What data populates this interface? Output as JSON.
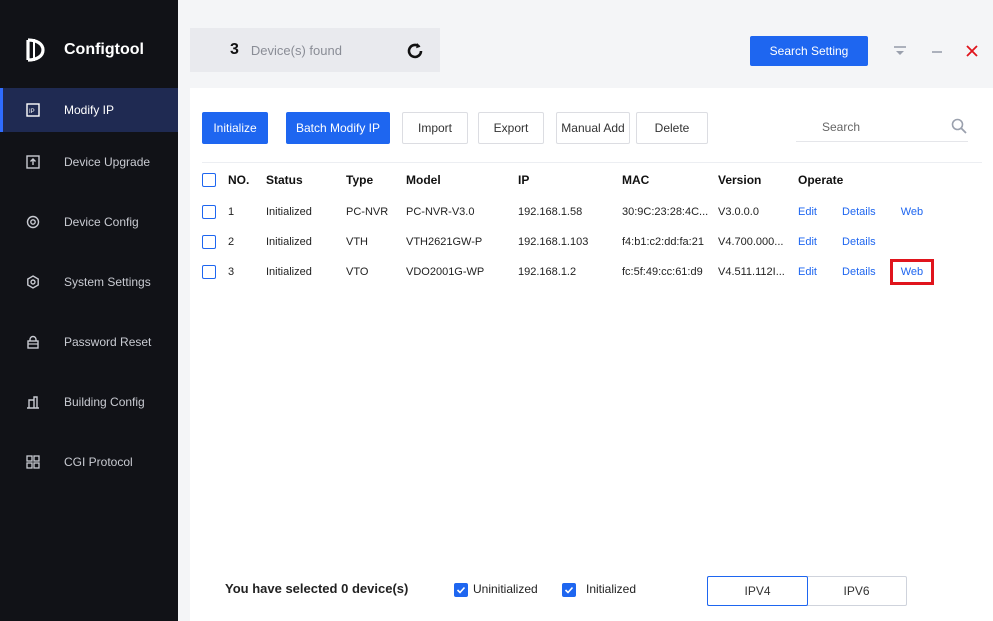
{
  "app": {
    "name": "Configtool"
  },
  "sidebar": {
    "items": [
      {
        "label": "Modify IP",
        "icon": "ip-icon",
        "active": true
      },
      {
        "label": "Device Upgrade",
        "icon": "upgrade-icon"
      },
      {
        "label": "Device Config",
        "icon": "device-config-icon"
      },
      {
        "label": "System Settings",
        "icon": "settings-icon"
      },
      {
        "label": "Password Reset",
        "icon": "lock-icon"
      },
      {
        "label": "Building Config",
        "icon": "building-icon"
      },
      {
        "label": "CGI Protocol",
        "icon": "cgi-icon"
      }
    ]
  },
  "topbar": {
    "device_count": "3",
    "found_label": "Device(s) found",
    "search_setting_label": "Search Setting"
  },
  "toolbar": {
    "initialize": "Initialize",
    "batch_modify": "Batch Modify IP",
    "import": "Import",
    "export": "Export",
    "manual_add": "Manual Add",
    "delete": "Delete",
    "search_placeholder": "Search"
  },
  "table": {
    "headers": [
      "NO.",
      "Status",
      "Type",
      "Model",
      "IP",
      "MAC",
      "Version",
      "Operate"
    ],
    "rows": [
      {
        "no": "1",
        "status": "Initialized",
        "type": "PC-NVR",
        "model": "PC-NVR-V3.0",
        "ip": "192.168.1.58",
        "mac": "30:9C:23:28:4C...",
        "version": "V3.0.0.0",
        "ops": [
          "Edit",
          "Details",
          "Web"
        ]
      },
      {
        "no": "2",
        "status": "Initialized",
        "type": "VTH",
        "model": "VTH2621GW-P",
        "ip": "192.168.1.103",
        "mac": "f4:b1:c2:dd:fa:21",
        "version": "V4.700.000...",
        "ops": [
          "Edit",
          "Details"
        ]
      },
      {
        "no": "3",
        "status": "Initialized",
        "type": "VTO",
        "model": "VDO2001G-WP",
        "ip": "192.168.1.2",
        "mac": "fc:5f:49:cc:61:d9",
        "version": "V4.511.112I...",
        "ops": [
          "Edit",
          "Details",
          "Web"
        ]
      }
    ]
  },
  "footer": {
    "selected_prefix": "You have selected",
    "selected_count": "0",
    "selected_suffix": "device(s)",
    "uninitialized_label": "Uninitialized",
    "initialized_label": "Initialized",
    "ipv4_label": "IPV4",
    "ipv6_label": "IPV6"
  },
  "colors": {
    "accent": "#1e66f0",
    "sidebar_bg": "#111217",
    "highlight": "#e0141c"
  }
}
